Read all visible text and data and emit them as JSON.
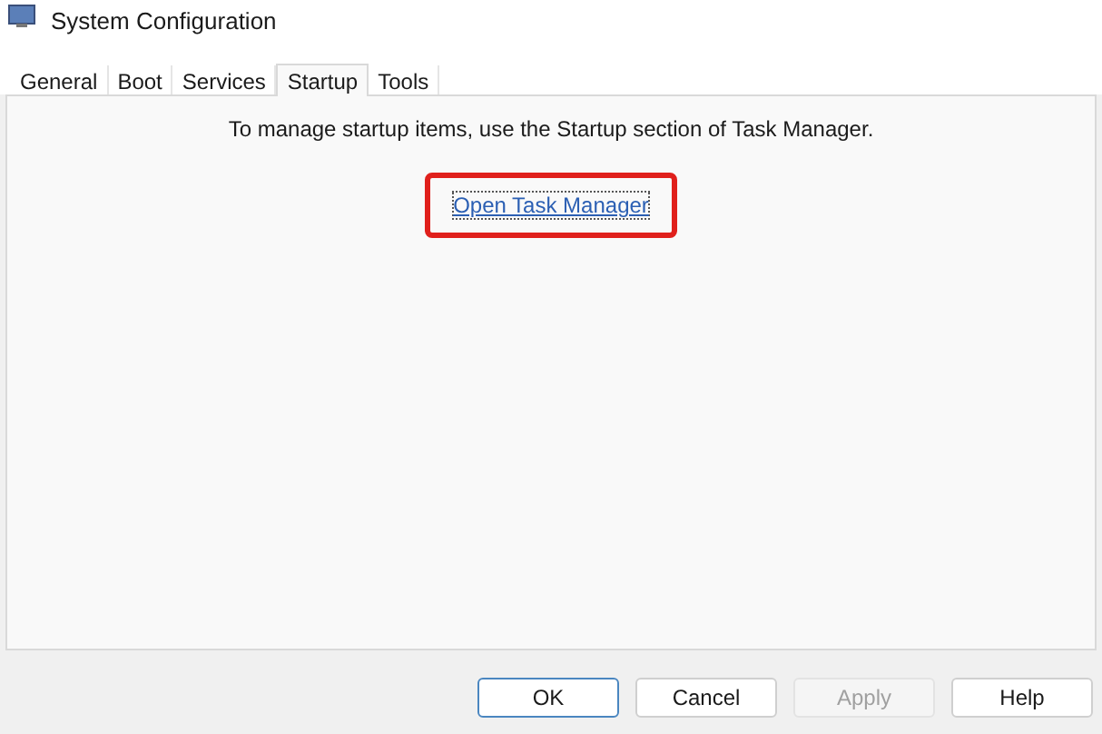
{
  "window": {
    "title": "System Configuration"
  },
  "tabs": [
    {
      "label": "General",
      "selected": false
    },
    {
      "label": "Boot",
      "selected": false
    },
    {
      "label": "Services",
      "selected": false
    },
    {
      "label": "Startup",
      "selected": true
    },
    {
      "label": "Tools",
      "selected": false
    }
  ],
  "startup": {
    "message": "To manage startup items, use the Startup section of Task Manager.",
    "link": "Open Task Manager",
    "highlighted": true
  },
  "buttons": [
    {
      "label": "OK",
      "default": true,
      "disabled": false
    },
    {
      "label": "Cancel",
      "default": false,
      "disabled": false
    },
    {
      "label": "Apply",
      "default": false,
      "disabled": true
    },
    {
      "label": "Help",
      "default": false,
      "disabled": false
    }
  ]
}
